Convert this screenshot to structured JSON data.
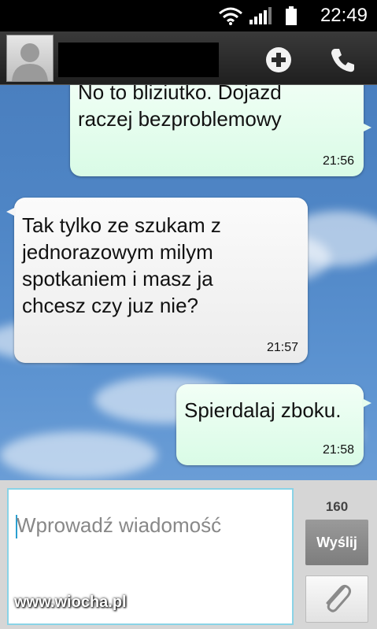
{
  "status_bar": {
    "time": "22:49"
  },
  "header": {
    "contact_name_redacted": true
  },
  "messages": [
    {
      "direction": "outgoing",
      "text": "No to bliziutko. Dojazd\nraczej bezproblemowy",
      "time": "21:56"
    },
    {
      "direction": "incoming",
      "text": " Tak tylko ze szukam z\njednorazowym milym\nspotkaniem i masz ja\nchcesz czy juz nie?",
      "time": "21:57"
    },
    {
      "direction": "outgoing",
      "text": "Spierdalaj zboku.",
      "time": "21:58"
    }
  ],
  "composer": {
    "placeholder": "Wprowadź wiadomość",
    "char_count": "160",
    "send_label": "Wyślij"
  },
  "watermark": "www.wiocha.pl",
  "icons": [
    "wifi-icon",
    "signal-icon",
    "battery-icon",
    "contact-avatar-icon",
    "add-contact-icon",
    "phone-icon",
    "paperclip-icon"
  ],
  "colors": {
    "outgoing_bubble": "#e6fcee",
    "incoming_bubble": "#f4f4f4",
    "background": "#4f86c6",
    "input_border": "#8ad3e6"
  }
}
